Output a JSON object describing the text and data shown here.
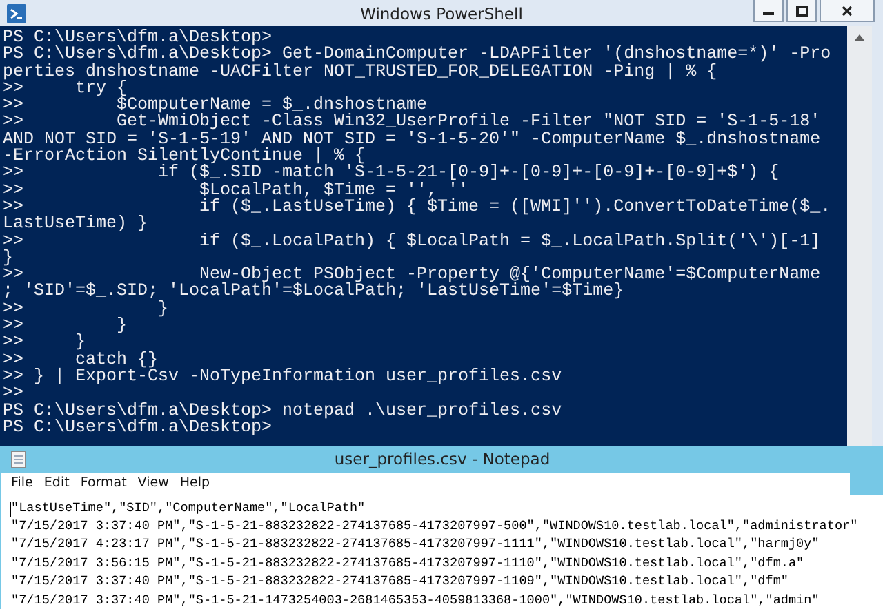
{
  "powershell": {
    "title": "Windows PowerShell",
    "lines": [
      "PS C:\\Users\\dfm.a\\Desktop>",
      "PS C:\\Users\\dfm.a\\Desktop> Get-DomainComputer -LDAPFilter '(dnshostname=*)' -Pro",
      "perties dnshostname -UACFilter NOT_TRUSTED_FOR_DELEGATION -Ping | % {",
      ">>     try {",
      ">>         $ComputerName = $_.dnshostname",
      ">>         Get-WmiObject -Class Win32_UserProfile -Filter \"NOT SID = 'S-1-5-18'",
      "AND NOT SID = 'S-1-5-19' AND NOT SID = 'S-1-5-20'\" -ComputerName $_.dnshostname",
      "-ErrorAction SilentlyContinue | % {",
      ">>             if ($_.SID -match 'S-1-5-21-[0-9]+-[0-9]+-[0-9]+-[0-9]+$') {",
      ">>                 $LocalPath, $Time = '', ''",
      ">>                 if ($_.LastUseTime) { $Time = ([WMI]'').ConvertToDateTime($_.",
      "LastUseTime) }",
      ">>                 if ($_.LocalPath) { $LocalPath = $_.LocalPath.Split('\\')[-1]",
      "}",
      ">>                 New-Object PSObject -Property @{'ComputerName'=$ComputerName",
      "; 'SID'=$_.SID; 'LocalPath'=$LocalPath; 'LastUseTime'=$Time}",
      ">>             }",
      ">>         }",
      ">>     }",
      ">>     catch {}",
      ">> } | Export-Csv -NoTypeInformation user_profiles.csv",
      ">>",
      "PS C:\\Users\\dfm.a\\Desktop> notepad .\\user_profiles.csv",
      "PS C:\\Users\\dfm.a\\Desktop>"
    ]
  },
  "notepad": {
    "title": "user_profiles.csv - Notepad",
    "menu": [
      "File",
      "Edit",
      "Format",
      "View",
      "Help"
    ],
    "lines": [
      "\"LastUseTime\",\"SID\",\"ComputerName\",\"LocalPath\"",
      "\"7/15/2017 3:37:40 PM\",\"S-1-5-21-883232822-274137685-4173207997-500\",\"WINDOWS10.testlab.local\",\"administrator\"",
      "\"7/15/2017 4:23:17 PM\",\"S-1-5-21-883232822-274137685-4173207997-1111\",\"WINDOWS10.testlab.local\",\"harmj0y\"",
      "\"7/15/2017 3:56:15 PM\",\"S-1-5-21-883232822-274137685-4173207997-1110\",\"WINDOWS10.testlab.local\",\"dfm.a\"",
      "\"7/15/2017 3:37:40 PM\",\"S-1-5-21-883232822-274137685-4173207997-1109\",\"WINDOWS10.testlab.local\",\"dfm\"",
      "\"7/15/2017 3:37:40 PM\",\"S-1-5-21-1473254003-2681465353-4059813368-1000\",\"WINDOWS10.testlab.local\",\"admin\""
    ]
  }
}
